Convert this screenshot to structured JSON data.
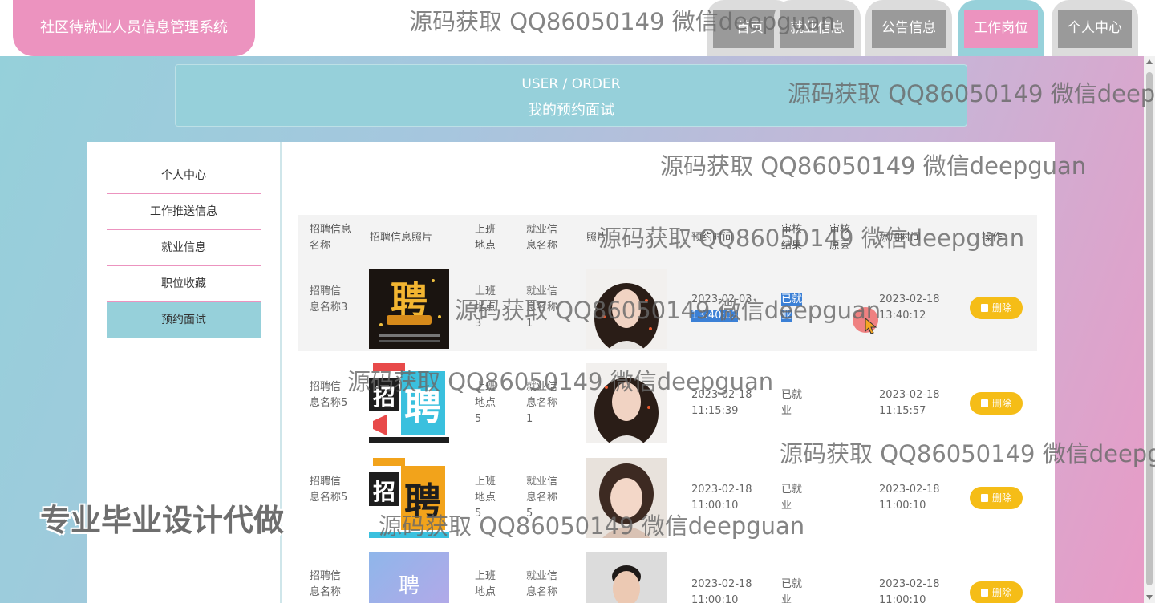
{
  "app": {
    "title": "社区待就业人员信息管理系统"
  },
  "nav": {
    "items": [
      {
        "label": "首页",
        "active": false
      },
      {
        "label": "就业信息",
        "active": false
      },
      {
        "label": "公告信息",
        "active": false
      },
      {
        "label": "工作岗位",
        "active": true
      },
      {
        "label": "个人中心",
        "active": false
      }
    ]
  },
  "breadcrumb": {
    "en": "USER / ORDER",
    "cn": "我的预约面试"
  },
  "sidebar": {
    "items": [
      {
        "label": "个人中心",
        "active": false
      },
      {
        "label": "工作推送信息",
        "active": false
      },
      {
        "label": "就业信息",
        "active": false
      },
      {
        "label": "职位收藏",
        "active": false
      },
      {
        "label": "预约面试",
        "active": true
      }
    ]
  },
  "table": {
    "headers": [
      "招聘信息名称",
      "招聘信息照片",
      "上班地点",
      "就业信息名称",
      "照片",
      "预约时间",
      "审核结果",
      "审核原因",
      "添加时间",
      "操作"
    ],
    "rows": [
      {
        "name": "招聘信息名称3",
        "location": "上班地点3",
        "job": "就业信息名称1",
        "appt_date": "2023-02-03",
        "appt_time": "13:40:03",
        "result": "已就业",
        "reason": "",
        "added_date": "2023-02-18",
        "added_time": "13:40:12",
        "delete_label": "删除"
      },
      {
        "name": "招聘信息名称5",
        "location": "上班地点5",
        "job": "就业信息名称1",
        "appt_date": "2023-02-18",
        "appt_time": "11:15:39",
        "result": "已就业",
        "reason": "",
        "added_date": "2023-02-18",
        "added_time": "11:15:57",
        "delete_label": "删除"
      },
      {
        "name": "招聘信息名称5",
        "location": "上班地点5",
        "job": "就业信息名称5",
        "appt_date": "2023-02-18",
        "appt_time": "11:00:10",
        "result": "已就业",
        "reason": "",
        "added_date": "2023-02-18",
        "added_time": "11:00:10",
        "delete_label": "删除"
      },
      {
        "name": "招聘信息名称",
        "location": "上班地点",
        "job": "就业信息名称",
        "appt_date": "2023-02-18",
        "appt_time": "11:00:10",
        "result": "已就业",
        "reason": "",
        "added_date": "2023-02-18",
        "added_time": "11:00:10",
        "delete_label": "删除"
      }
    ]
  },
  "overlays": {
    "watermark": "源码获取 QQ86050149 微信deepguan",
    "ad": "专业毕业设计代做",
    "poster_char": "聘",
    "poster_char_2": "招"
  },
  "colors": {
    "brand_pink": "#ec93bf",
    "brand_teal": "#96d0da",
    "delete_yellow": "#f5bd17"
  }
}
